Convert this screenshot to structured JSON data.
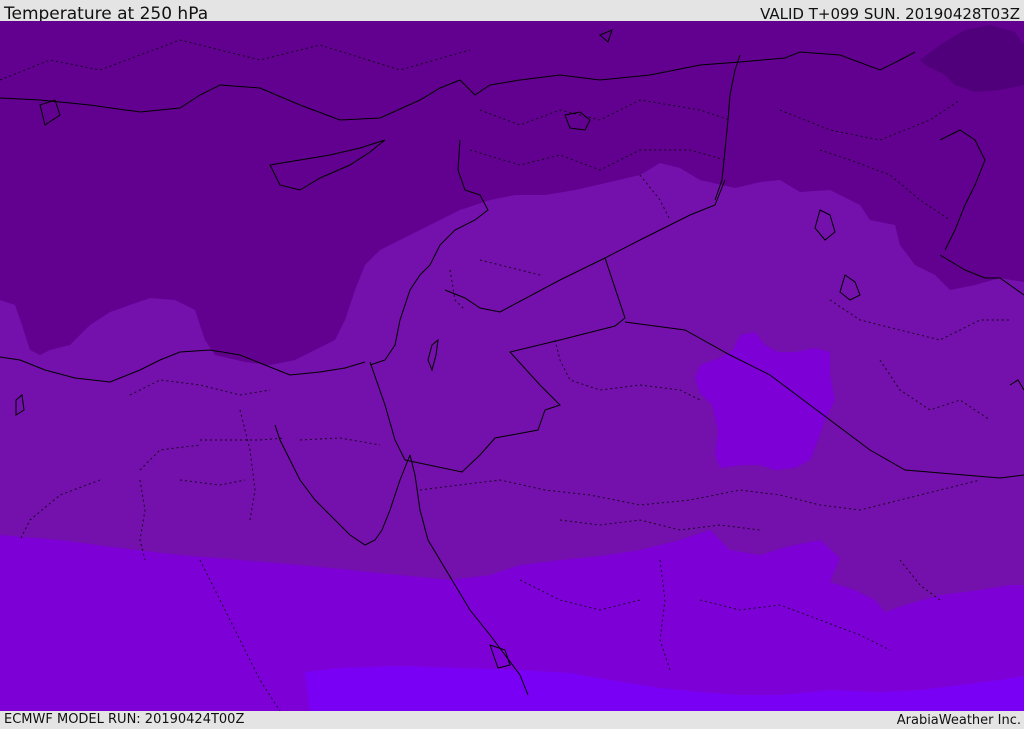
{
  "header": {
    "title": "Temperature at 250 hPa",
    "valid": "VALID T+099 SUN. 20190428T03Z"
  },
  "footer": {
    "model_run": "ECMWF MODEL RUN: 20190424T00Z",
    "credit": "ArabiaWeather Inc."
  },
  "map": {
    "field": "Temperature at 250 hPa",
    "palette": {
      "darkest": "#4f007a",
      "dark": "#62008f",
      "medium": "#7410ab",
      "light": "#7d00d6",
      "lightest": "#7a00f5",
      "border_line": "#000000"
    }
  }
}
